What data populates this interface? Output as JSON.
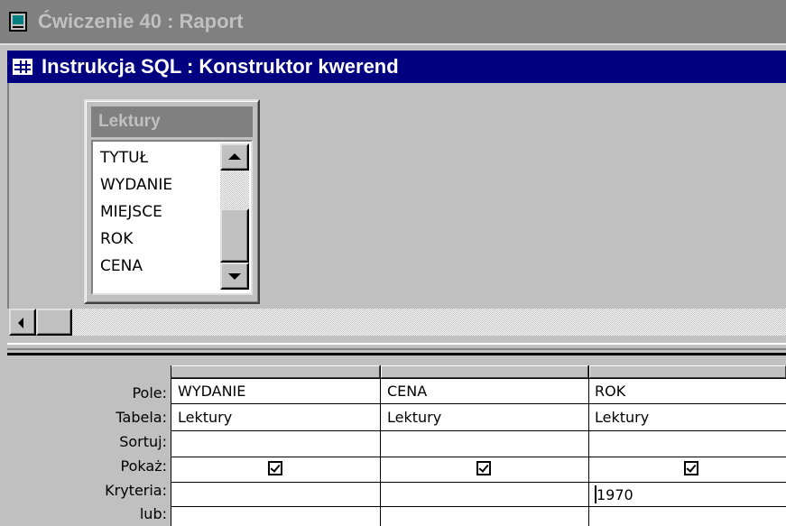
{
  "outer_window": {
    "title": "Ćwiczenie 40 : Raport",
    "icon": "form-icon"
  },
  "query_window": {
    "title": "Instrukcja SQL : Konstruktor kwerend",
    "icon": "datasheet-grid-icon"
  },
  "table_box": {
    "title": "Lektury",
    "fields": [
      "TYTUŁ",
      "WYDANIE",
      "MIEJSCE",
      "ROK",
      "CENA"
    ]
  },
  "qbe_grid": {
    "row_labels": [
      "Pole:",
      "Tabela:",
      "Sortuj:",
      "Pokaż:",
      "Kryteria:",
      "lub:"
    ],
    "columns": [
      {
        "field": "WYDANIE",
        "table": "Lektury",
        "sort": "",
        "show": true,
        "criteria": "",
        "or": ""
      },
      {
        "field": "CENA",
        "table": "Lektury",
        "sort": "",
        "show": true,
        "criteria": "",
        "or": ""
      },
      {
        "field": "ROK",
        "table": "Lektury",
        "sort": "",
        "show": true,
        "criteria": "1970",
        "or": ""
      }
    ]
  },
  "colors": {
    "active_title_bg": "#000080",
    "inactive_title_bg": "#808080",
    "window_bg": "#c0c0c0"
  }
}
